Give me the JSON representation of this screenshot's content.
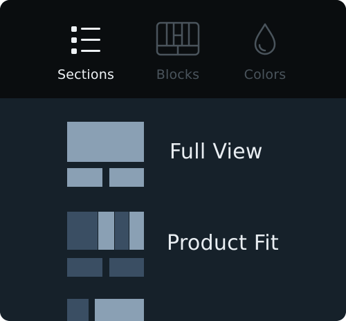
{
  "tabs": [
    {
      "label": "Sections",
      "icon": "list-icon",
      "active": true
    },
    {
      "label": "Blocks",
      "icon": "grid-blocks-icon",
      "active": false
    },
    {
      "label": "Colors",
      "icon": "droplet-icon",
      "active": false
    }
  ],
  "sections": [
    {
      "label": "Full View",
      "thumbnail": "full-view-thumbnail"
    },
    {
      "label": "Product Fit",
      "thumbnail": "product-fit-thumbnail"
    },
    {
      "label": "",
      "thumbnail": "partial-section-thumbnail"
    }
  ],
  "colors": {
    "tabbar_bg": "#0a0d0f",
    "content_bg": "#16212a",
    "active_text": "#eef2f5",
    "inactive_text": "#4a545c",
    "thumb_light": "#8aa0b4",
    "thumb_dark": "#3a4e63"
  }
}
